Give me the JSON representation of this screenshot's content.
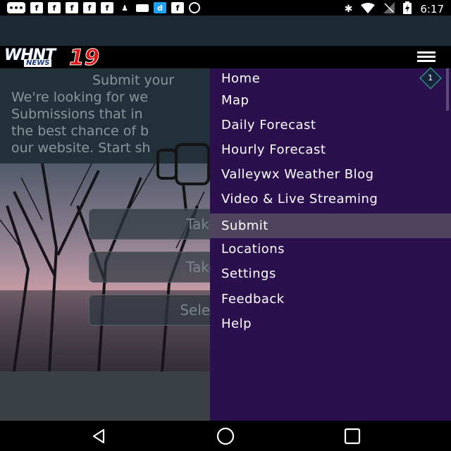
{
  "status_bar": {
    "time": "6:17",
    "left_icons": [
      "messages-icon",
      "facebook-icon",
      "facebook-icon",
      "facebook-icon",
      "facebook-icon",
      "facebook-icon",
      "person-icon",
      "wallet-icon",
      "dictionary-icon",
      "facebook-icon",
      "circle-alert-icon"
    ],
    "right_icons": [
      "bluetooth-icon",
      "wifi-icon",
      "no-signal-icon",
      "battery-charging-icon"
    ]
  },
  "header": {
    "logo_text": "WHNT",
    "logo_sub": "NEWS",
    "logo_number": "19"
  },
  "main": {
    "intro_title": "Submit your",
    "intro_lines": [
      "We're looking for we",
      "Submissions that in",
      "the best chance of b",
      "our website. Start sh"
    ],
    "buttons": [
      "Take N",
      "Take N",
      "Select fr"
    ]
  },
  "drawer": {
    "home_badge": "1",
    "items": [
      {
        "label": "Home"
      },
      {
        "label": "Map"
      },
      {
        "label": "Daily Forecast"
      },
      {
        "label": "Hourly Forecast"
      },
      {
        "label": "Valleywx Weather Blog"
      },
      {
        "label": "Video & Live Streaming"
      },
      {
        "label": "Submit"
      },
      {
        "label": "Locations"
      },
      {
        "label": "Settings"
      },
      {
        "label": "Feedback"
      },
      {
        "label": "Help"
      }
    ],
    "active_item": "Submit",
    "colors": {
      "background": "#2a114e",
      "active": "#4e4460",
      "badge_border": "#3bbf9c"
    }
  },
  "nav_bar": {
    "buttons": [
      "back-icon",
      "home-icon",
      "recents-icon"
    ]
  }
}
